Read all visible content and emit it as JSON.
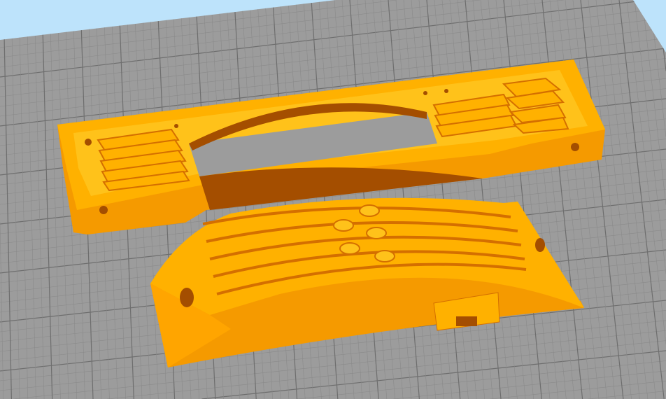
{
  "colors": {
    "background": "#bde3fb",
    "plate": "#9c9c9c",
    "grid_minor": "#8a8a8a",
    "grid_major": "#6e6e6e",
    "part_top": "#ffb100",
    "part_light": "#ffc21a",
    "part_side": "#f59a00",
    "part_dark": "#d46f00",
    "part_shadow": "#a44e00"
  }
}
